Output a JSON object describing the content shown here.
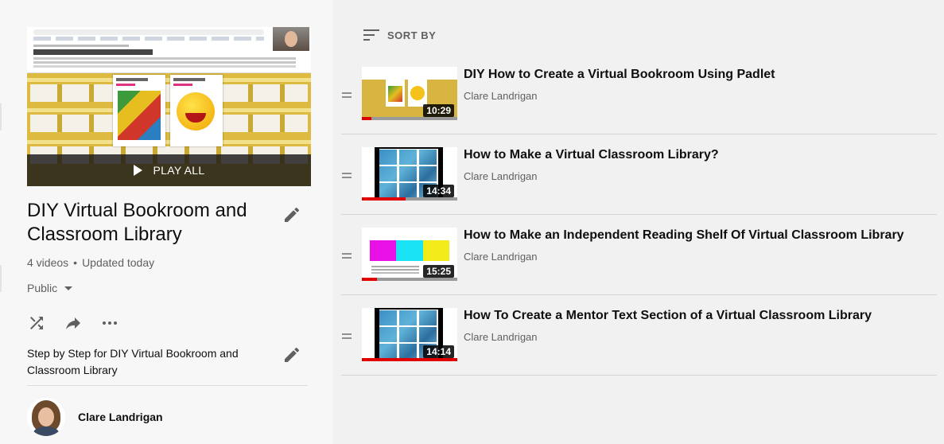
{
  "playlist": {
    "play_all_label": "PLAY ALL",
    "title": "DIY Virtual Bookroom and Classroom Library",
    "video_count": "4 videos",
    "separator": "•",
    "updated": "Updated today",
    "privacy": "Public",
    "description": "Step by Step for DIY Virtual Bookroom and Classroom Library",
    "owner": "Clare Landrigan",
    "hero_texts": {
      "heading": "Student Independent Reading",
      "card1": "Clare Landrigan",
      "card1_label": "Familiar Texts",
      "card2": "Clare Landrigan",
      "card2_label": "Unit"
    }
  },
  "actions": {
    "shuffle_icon": "shuffle-icon",
    "share_icon": "share-icon",
    "more_icon": "more-horiz-icon",
    "edit_icon": "pencil-icon"
  },
  "sort": {
    "label": "SORT BY",
    "icon": "sort-icon"
  },
  "videos": [
    {
      "title": "DIY How to Create a Virtual Bookroom Using Padlet",
      "channel": "Clare Landrigan",
      "duration": "10:29",
      "progress_pct": 10
    },
    {
      "title": "How to Make a Virtual Classroom Library?",
      "channel": "Clare Landrigan",
      "duration": "14:34",
      "progress_pct": 46
    },
    {
      "title": "How to Make an Independent Reading Shelf Of Virtual Classroom Library",
      "channel": "Clare Landrigan",
      "duration": "15:25",
      "progress_pct": 16
    },
    {
      "title": "How To Create a Mentor Text Section of a Virtual Classroom Library",
      "channel": "Clare Landrigan",
      "duration": "14:14",
      "progress_pct": 100
    }
  ],
  "colors": {
    "progress": "#e00000",
    "progress_track": "#9a9a9a",
    "secondary_text": "#606060",
    "shelf_colors": [
      "#e810e6",
      "#19e3f2",
      "#f2ea19"
    ]
  }
}
